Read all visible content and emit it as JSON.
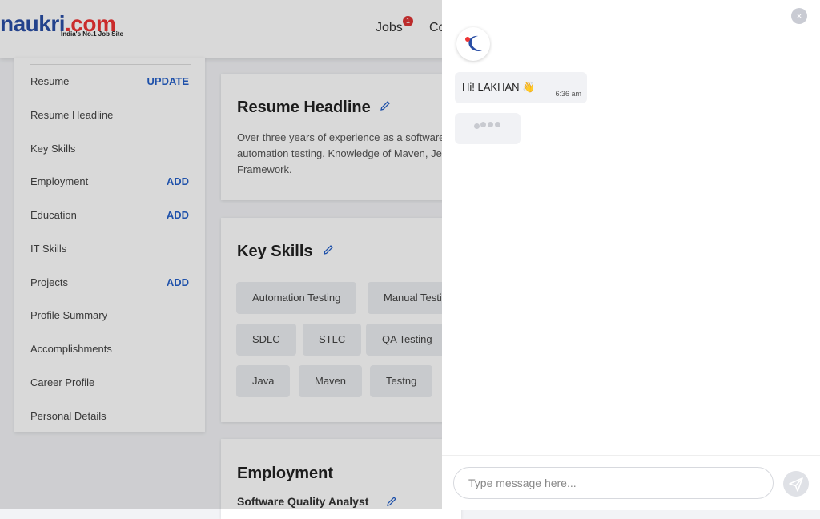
{
  "header": {
    "logo_text": "naukri",
    "logo_suffix": ".com",
    "logo_tagline": "India's No.1 Job Site",
    "nav_jobs": "Jobs",
    "nav_jobs_badge": "1",
    "nav_companies_partial": "Co"
  },
  "sidebar": {
    "items": [
      {
        "label": "Resume",
        "action": "UPDATE"
      },
      {
        "label": "Resume Headline",
        "action": ""
      },
      {
        "label": "Key Skills",
        "action": ""
      },
      {
        "label": "Employment",
        "action": "ADD"
      },
      {
        "label": "Education",
        "action": "ADD"
      },
      {
        "label": "IT Skills",
        "action": ""
      },
      {
        "label": "Projects",
        "action": "ADD"
      },
      {
        "label": "Profile Summary",
        "action": ""
      },
      {
        "label": "Accomplishments",
        "action": ""
      },
      {
        "label": "Career Profile",
        "action": ""
      },
      {
        "label": "Personal Details",
        "action": ""
      }
    ]
  },
  "resume_headline": {
    "title": "Resume Headline",
    "line1": "Over three years of experience as a software",
    "line2": "automation testing. Knowledge of Maven, Je",
    "line3": "Framework."
  },
  "key_skills": {
    "title": "Key Skills",
    "chips": [
      "Automation Testing",
      "Manual Testi",
      "SDLC",
      "STLC",
      "QA Testing",
      "Java",
      "Maven",
      "Testng"
    ]
  },
  "employment": {
    "title": "Employment",
    "role": "Software Quality Analyst"
  },
  "chat": {
    "close_label": "×",
    "greeting": "Hi! LAKHAN 👋",
    "greeting_time": "6:36 am",
    "input_placeholder": "Type message here...",
    "icons": {
      "close": "close-icon",
      "bot_avatar": "naukri-logo-icon",
      "typing": "typing-dots-icon",
      "send": "send-icon"
    }
  },
  "colors": {
    "brand_blue": "#2a4ea5",
    "accent_red": "#e33",
    "link_blue": "#2560c8"
  }
}
